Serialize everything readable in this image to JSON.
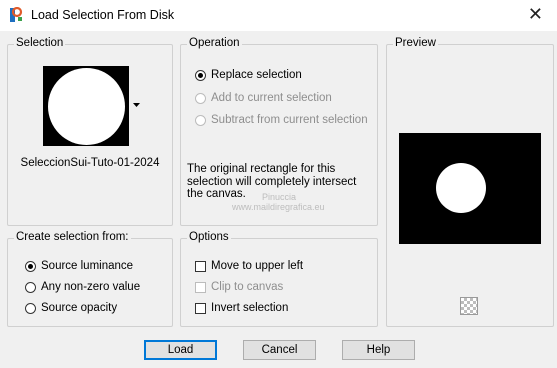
{
  "window": {
    "title": "Load Selection From Disk",
    "close_glyph": "✕"
  },
  "selection": {
    "label": "Selection",
    "filename": "SeleccionSui-Tuto-01-2024"
  },
  "operation": {
    "label": "Operation",
    "options": [
      {
        "label": "Replace selection",
        "checked": true,
        "enabled": true
      },
      {
        "label": "Add to current selection",
        "checked": false,
        "enabled": false
      },
      {
        "label": "Subtract from current selection",
        "checked": false,
        "enabled": false
      }
    ],
    "info_text": "The original rectangle for this selection will completely intersect the canvas."
  },
  "preview": {
    "label": "Preview"
  },
  "create_from": {
    "label": "Create selection from:",
    "options": [
      {
        "label": "Source luminance",
        "checked": true
      },
      {
        "label": "Any non-zero value",
        "checked": false
      },
      {
        "label": "Source opacity",
        "checked": false
      }
    ]
  },
  "options": {
    "label": "Options",
    "items": [
      {
        "label": "Move to upper left",
        "checked": false,
        "enabled": true
      },
      {
        "label": "Clip to canvas",
        "checked": false,
        "enabled": false
      },
      {
        "label": "Invert selection",
        "checked": false,
        "enabled": true
      }
    ]
  },
  "buttons": {
    "load": "Load",
    "cancel": "Cancel",
    "help": "Help"
  },
  "watermark": {
    "line1": "Pinuccia",
    "line2": "www.maildiregrafica.eu"
  },
  "colors": {
    "accent": "#0078d7",
    "dialog_bg": "#f0f0f0"
  }
}
